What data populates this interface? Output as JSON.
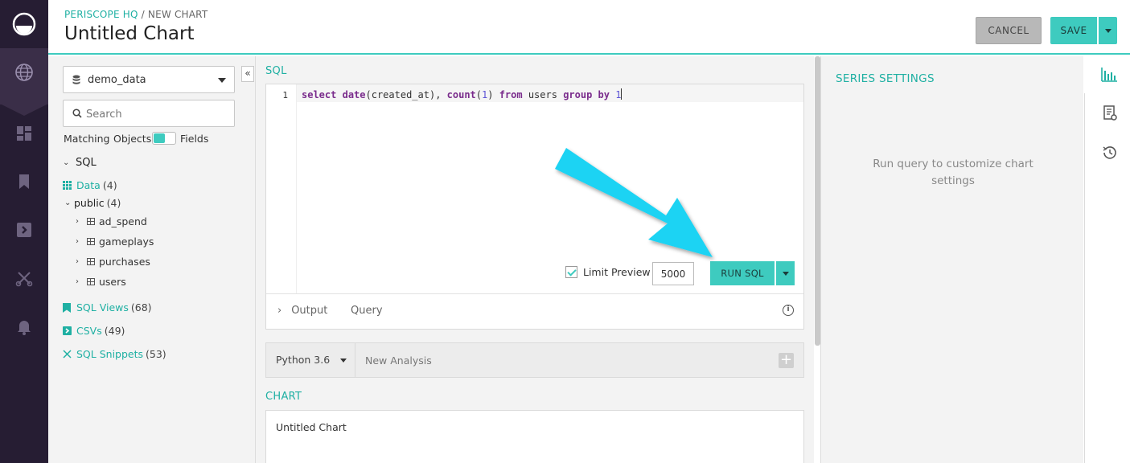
{
  "header": {
    "org": "PERISCOPE HQ",
    "separator": " / ",
    "section": "NEW CHART",
    "title": "Untitled Chart",
    "cancel_label": "CANCEL",
    "save_label": "SAVE"
  },
  "sidebar": {
    "database": "demo_data",
    "search_placeholder": "Search",
    "matching_label": "Matching",
    "objects_label": "Objects",
    "fields_label": "Fields",
    "sql_label": "SQL",
    "data": {
      "label": "Data",
      "count": "(4)"
    },
    "public": {
      "label": "public",
      "count": "(4)"
    },
    "tables": [
      "ad_spend",
      "gameplays",
      "purchases",
      "users"
    ],
    "sql_views": {
      "label": "SQL Views",
      "count": "(68)"
    },
    "csvs": {
      "label": "CSVs",
      "count": "(49)"
    },
    "snippets": {
      "label": "SQL Snippets",
      "count": "(53)"
    }
  },
  "editor": {
    "section_label": "SQL",
    "line_number": "1",
    "limit_preview_label": "Limit Preview",
    "limit_value": "5000",
    "run_label": "RUN SQL",
    "output_label": "Output",
    "query_label": "Query"
  },
  "python": {
    "version": "Python 3.6",
    "new_analysis": "New Analysis"
  },
  "chart": {
    "section_label": "CHART",
    "name": "Untitled Chart"
  },
  "series": {
    "title": "SERIES SETTINGS",
    "message": "Run query to customize chart settings"
  },
  "colors": {
    "accent": "#3ecbbf",
    "rail": "#261d33",
    "annotation_arrow": "#1fd3f3"
  }
}
